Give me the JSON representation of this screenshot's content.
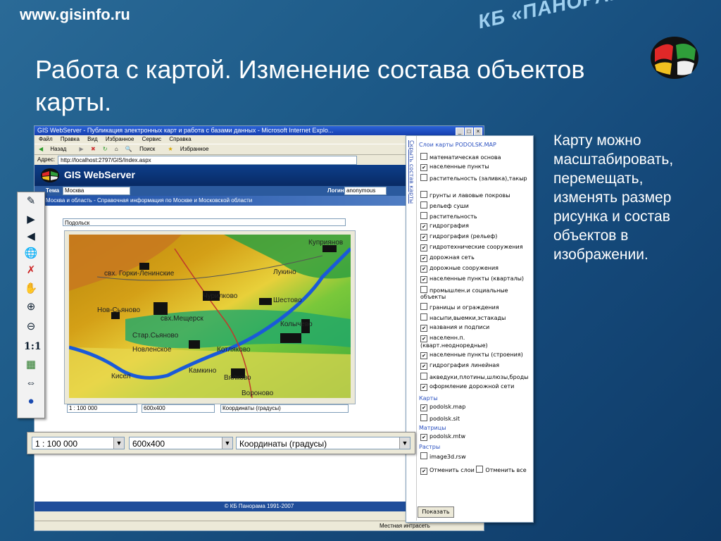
{
  "slide": {
    "site_url": "www.gisinfo.ru",
    "brand": "КБ «ПАНОРАМА»",
    "title": "Работа с картой. Изменение состава объектов карты.",
    "description": "Карту можно масштабировать, перемещать, изменять размер рисунка и состав объектов в изображении."
  },
  "browser": {
    "window_title": "GIS WebServer - Публикация электронных карт и работа с базами данных - Microsoft Internet Explo...",
    "menu": [
      "Файл",
      "Правка",
      "Вид",
      "Избранное",
      "Сервис",
      "Справка"
    ],
    "toolbar": [
      "Назад",
      "Поиск",
      "Избранное"
    ],
    "address_label": "Адрес:",
    "address": "http://localhost:2797/GIS/Index.aspx",
    "status_text": "Местная интрасеть"
  },
  "app": {
    "name": "GIS WebServer",
    "theme_label": "Тема",
    "theme_value": "Москва",
    "login_label": "Логин",
    "login_value": "anonymous",
    "info": "Москва и область - Справочная информация по Москве и Московской области",
    "region": "Подольск",
    "footer": "© КБ Панорама 1991-2007"
  },
  "map": {
    "labels": [
      "Куприянов",
      "свх. Горки-Ленинские",
      "Лукино",
      "Чурилково",
      "Шестово",
      "Нов-Сьяново",
      "свх.Мещерск",
      "Колычево",
      "Стар.Сьяново",
      "Новленское",
      "Котляково",
      "Кисел",
      "Камкино",
      "Вялково",
      "Вороново"
    ]
  },
  "controls": {
    "scale": "1 : 100 000",
    "size": "600x400",
    "coords": "Координаты (градусы)"
  },
  "layers": {
    "tab_label": "Скрыть состав карты",
    "title": "Слои карты PODOLSK.MAP",
    "items": [
      {
        "label": "математическая основа",
        "checked": false
      },
      {
        "label": "населенные пункты",
        "checked": true
      },
      {
        "label": "растительность (заливка),такыр",
        "checked": false
      },
      {
        "label": "грунты и лавовые покровы",
        "checked": false
      },
      {
        "label": "рельеф суши",
        "checked": false
      },
      {
        "label": "растительность",
        "checked": false
      },
      {
        "label": "гидрография",
        "checked": true
      },
      {
        "label": "гидрография (рельеф)",
        "checked": true
      },
      {
        "label": "гидротехнические сооружения",
        "checked": true
      },
      {
        "label": "дорожная сеть",
        "checked": true
      },
      {
        "label": "дорожные сооружения",
        "checked": true
      },
      {
        "label": "населенные пункты (кварталы)",
        "checked": true
      },
      {
        "label": "промышлен.и социальные объекты",
        "checked": false
      },
      {
        "label": "границы и ограждения",
        "checked": false
      },
      {
        "label": "насыпи,выемки,эстакады",
        "checked": false
      },
      {
        "label": "названия и подписи",
        "checked": true
      },
      {
        "label": "населенн.п. (кварт.неодноредные)",
        "checked": true
      },
      {
        "label": "населенные пункты (строения)",
        "checked": true
      },
      {
        "label": "гидрография линейная",
        "checked": true
      },
      {
        "label": "акведуки,плотины,шлюзы,броды",
        "checked": false
      },
      {
        "label": "оформление дорожной сети",
        "checked": true
      }
    ],
    "maps_head": "Карты",
    "maps": [
      {
        "label": "podolsk.map",
        "checked": true
      },
      {
        "label": "podolsk.sit",
        "checked": false
      }
    ],
    "matrices_head": "Матрицы",
    "matrices": [
      {
        "label": "podolsk.mtw",
        "checked": true
      }
    ],
    "rasters_head": "Растры",
    "rasters": [
      {
        "label": "image3d.rsw",
        "checked": false
      }
    ],
    "select_all": "Отменить слои",
    "deselect_all": "Отменить все",
    "show_button": "Показать"
  },
  "tools": {
    "ratio_label": "1:1",
    "icons": [
      "select-icon",
      "arrow-right-icon",
      "arrow-left-icon",
      "globe-search-icon",
      "cancel-select-icon",
      "pan-hand-icon",
      "zoom-in-icon",
      "zoom-out-icon",
      "ratio-icon",
      "map-info-icon",
      "measure-icon",
      "globe-icon"
    ]
  },
  "colors": {
    "background": "#1d5a88",
    "header_blue": "#0d3e8a",
    "link_blue": "#2a50c0"
  }
}
